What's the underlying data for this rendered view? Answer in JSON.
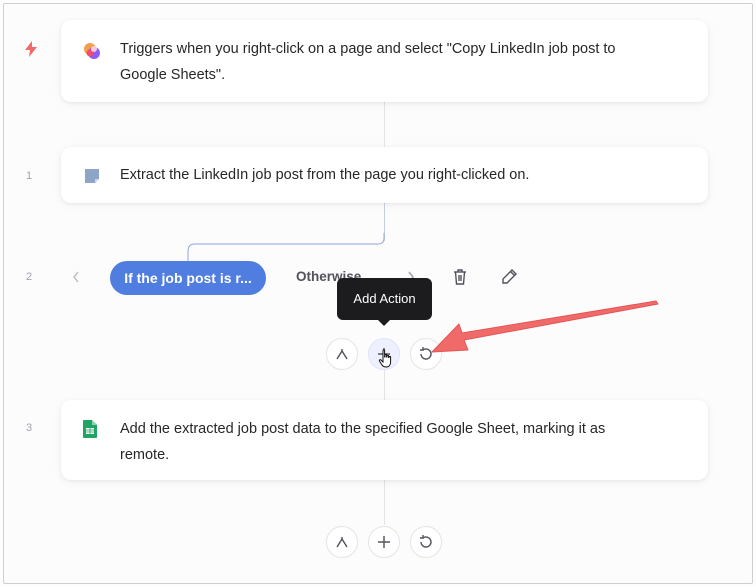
{
  "trigger": {
    "text": "Triggers when you right-click on a page and select \"Copy LinkedIn job post to Google Sheets\"."
  },
  "steps": [
    {
      "number": "1",
      "text": "Extract the LinkedIn job post from the page you right-clicked on."
    },
    {
      "number": "2"
    },
    {
      "number": "3",
      "text": "Add the extracted job post data to the specified Google Sheet, marking it as remote."
    }
  ],
  "branch": {
    "active_label": "If the job post is r...",
    "other_label": "Otherwise"
  },
  "tooltip": {
    "text": "Add Action"
  },
  "colors": {
    "accent": "#4f7de0",
    "arrow": "#f06a6a",
    "tooltip_bg": "#1c1c1e",
    "sheets_green": "#1fa463"
  }
}
